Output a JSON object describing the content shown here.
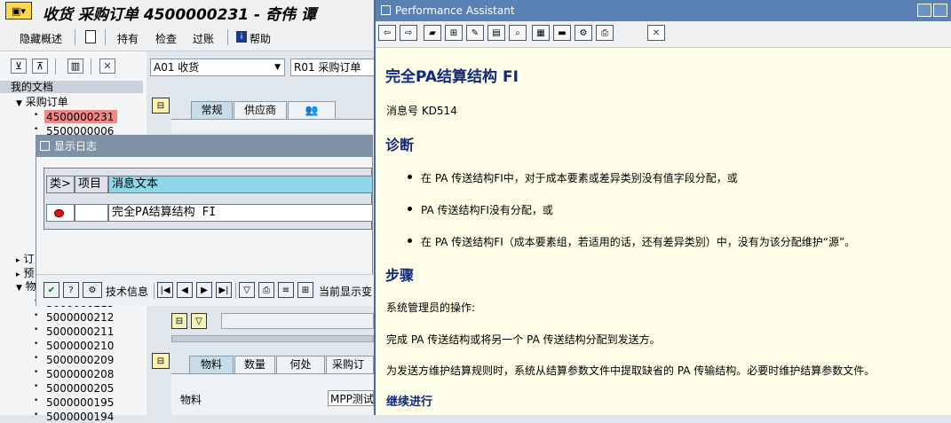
{
  "sap": {
    "title": "收货 采购订单 4500000231 - 奇伟 谭",
    "toolbar": {
      "hide_overview": "隐藏概述",
      "hold": "持有",
      "check": "检查",
      "post": "过账",
      "help": "帮助"
    },
    "left": {
      "my_docs": "我的文档",
      "po_node": "采购订单",
      "docs_top": [
        "4500000231",
        "5500000006"
      ],
      "collapsed": [
        "订",
        "预",
        "物"
      ],
      "docs_bottom": [
        "5000000213",
        "5000000212",
        "5000000211",
        "5000000210",
        "5000000209",
        "5000000208",
        "5000000205",
        "5000000195",
        "5000000194"
      ]
    },
    "combos": {
      "action": "A01 收货",
      "ref": "R01 采购订单"
    },
    "tabs_top": [
      "常规",
      "供应商"
    ],
    "tabs_item": [
      "物料",
      "数量",
      "何处",
      "采购订"
    ],
    "item_field": {
      "label": "物料",
      "value": "MPP测试"
    }
  },
  "log": {
    "title": "显示日志",
    "headers": {
      "type": "类>",
      "item": "项目",
      "text": "消息文本"
    },
    "row": {
      "text": "完全PA结算结构 FI"
    },
    "buttons": {
      "tech": "技术信息",
      "current": "当前显示变"
    }
  },
  "pa": {
    "title": "Performance Assistant",
    "heading": "完全PA结算结构 FI",
    "msg_no": "消息号 KD514",
    "diag": "诊断",
    "bullets": [
      "在 PA 传送结构FI中，对于成本要素或差异类别没有值字段分配，或",
      "PA 传送结构FI没有分配，或",
      "在 PA 传送结构FI（成本要素组，若适用的话，还有差异类别）中，没有为该分配维护“源”。"
    ],
    "steps": "步骤",
    "admin": "系统管理员的操作:",
    "p1": "完成 PA 传送结构或将另一个 PA 传送结构分配到发送方。",
    "p2": "为发送方维护结算规则时，系统从结算参数文件中提取缺省的 PA 传输结构。必要时维护结算参数文件。",
    "cont": "继续进行"
  },
  "colors": {
    "selected_doc": "#ee8a86",
    "pa_bg": "#fefee9",
    "heading": "#10287e"
  }
}
